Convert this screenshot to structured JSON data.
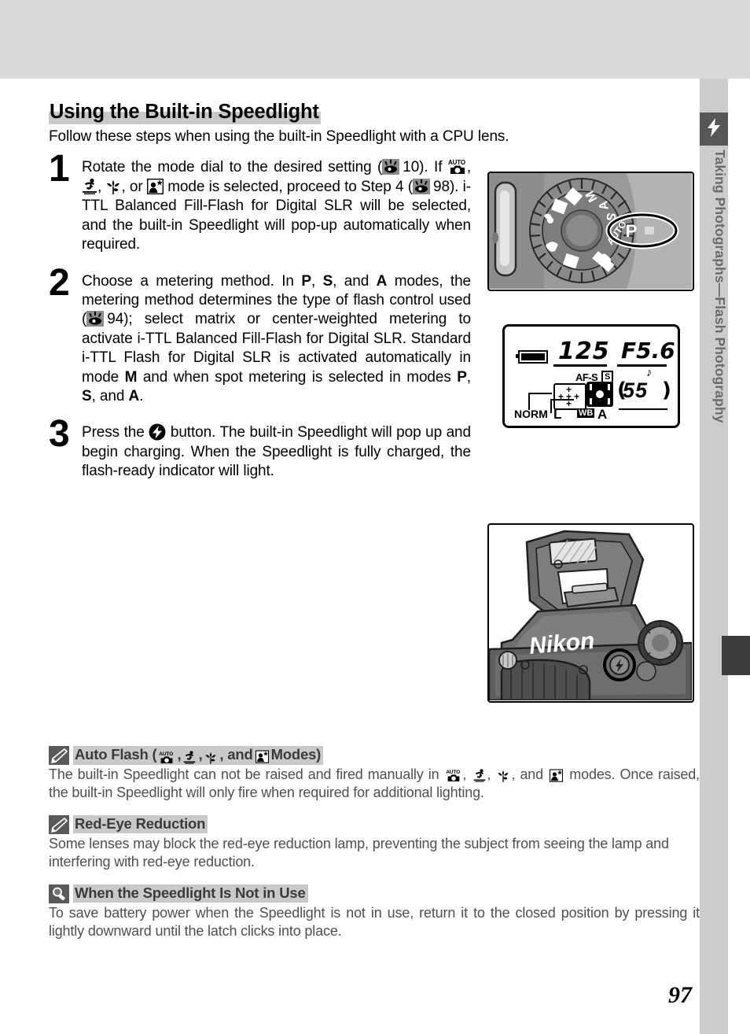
{
  "document": {
    "page_number": "97",
    "side_tab_label": "Taking Photographs—Flash Photography",
    "side_tab_icon": "flash-icon"
  },
  "heading": {
    "title": "Using the Built-in Speedlight",
    "intro": "Follow these steps when using the built-in Speedlight with a CPU lens."
  },
  "steps": [
    {
      "number": "1",
      "text_a": "Rotate the mode dial to the desired setting (",
      "ref_page_a": "10",
      "text_b": "). If ",
      "text_c": ", ",
      "text_d": ", or ",
      "text_e": " mode is selected, proceed to Step 4 (",
      "ref_page_b": "98",
      "text_f": "). i-TTL Balanced Fill-Flash for Digital SLR will be selected, and the built-in Speedlight will pop-up automatically when required."
    },
    {
      "number": "2",
      "text_a": "Choose a metering method. In ",
      "mode_p": "P",
      "mode_s": "S",
      "mode_a": "A",
      "text_b": " modes, the metering method determines the type of flash control used (",
      "ref_page": "94",
      "text_c": "); select matrix or center-weighted metering to activate i-TTL Balanced Fill-Flash for Digital SLR. Standard i-TTL Flash for Digital SLR is activated automatically in mode ",
      "mode_m": "M",
      "text_d": " and when spot metering is selected in modes "
    },
    {
      "number": "3",
      "text_a": "Press the ",
      "text_b": " button. The built-in Speedlight will pop up and begin charging. When the Speedlight is fully charged, the flash-ready indicator will light."
    }
  ],
  "figures": {
    "mode_dial": {
      "caption": "mode-dial-set-to-P",
      "selected_mode": "P",
      "dial_modes": [
        "M",
        "A",
        "S",
        "P",
        "AUTO",
        "portrait",
        "landscape",
        "macro",
        "sports",
        "night-landscape",
        "night-portrait"
      ]
    },
    "lcd": {
      "shutter_speed": "125",
      "aperture": "F5.6",
      "af_mode": "AF-S",
      "af_area_mode": "S",
      "frames_remaining": "55",
      "paren_left": "(",
      "paren_right": ")",
      "quality": "NORM",
      "image_size": "L",
      "wb_badge": "WB",
      "wb_value": "A",
      "beep": "♪",
      "af_grid_marks": "+"
    },
    "camera": {
      "brand": "Nikon",
      "caption": "camera-with-speedlight-raised"
    }
  },
  "notes": [
    {
      "icon": "pencil-icon",
      "title_a": "Auto Flash (",
      "title_b": ", ",
      "title_c": ", and ",
      "title_d": " Modes)",
      "body_a": "The built-in Speedlight can not be raised and fired manually in ",
      "body_b": ", ",
      "body_c": ", and ",
      "body_d": " modes. Once raised, the built-in Speedlight will only fire when required for additional lighting."
    },
    {
      "icon": "pencil-icon",
      "title": "Red-Eye Reduction",
      "body": "Some lenses may block the red-eye reduction lamp, preventing the subject from seeing the lamp and interfering with red-eye reduction."
    },
    {
      "icon": "magnifier-icon",
      "title": "When the Speedlight Is Not in Use",
      "body": "To save battery power when the Speedlight is not in use, return it to the closed position by pressing it lightly downward until the latch clicks into place."
    }
  ]
}
